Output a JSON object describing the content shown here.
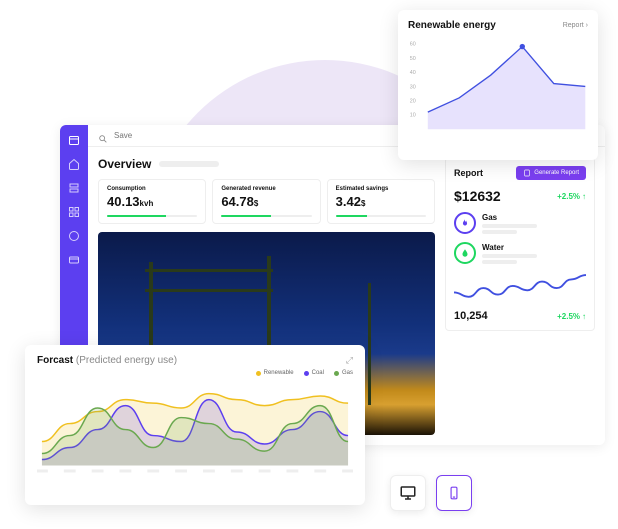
{
  "colors": {
    "primary": "#5c3ff0",
    "accent": "#7a3ff0",
    "green": "#1ed760"
  },
  "dots": "• • •",
  "search": {
    "placeholder": "Save"
  },
  "overview": {
    "title": "Overview"
  },
  "metrics": [
    {
      "label": "Consumption",
      "value": "40.13",
      "unit": "kvh",
      "progress": 65
    },
    {
      "label": "Generated revenue",
      "value": "64.78",
      "unit": "$",
      "progress": 55
    },
    {
      "label": "Estimated savings",
      "value": "3.42",
      "unit": "$",
      "progress": 35
    }
  ],
  "report": {
    "title": "Report",
    "generate_label": "Generate Report",
    "amount": "$12632",
    "change": "+2.5%",
    "resources": [
      {
        "name": "Gas",
        "kind": "gas"
      },
      {
        "name": "Water",
        "kind": "water"
      }
    ],
    "bottom_value": "10,254",
    "bottom_change": "+2.5%"
  },
  "renewable": {
    "title": "Renewable energy",
    "report_link": "Report"
  },
  "forecast": {
    "title": "Forcast",
    "subtitle": "(Predicted energy use)",
    "legend": [
      {
        "label": "Renewable",
        "color": "#f0c020"
      },
      {
        "label": "Coal",
        "color": "#5c3ff0"
      },
      {
        "label": "Gas",
        "color": "#6aa84f"
      }
    ]
  },
  "chart_data": [
    {
      "id": "renewable",
      "type": "area",
      "title": "Renewable energy",
      "ylabel": "",
      "ylim": [
        0,
        60
      ],
      "yticks": [
        10,
        20,
        30,
        40,
        50,
        60
      ],
      "x": [
        0,
        1,
        2,
        3,
        4,
        5
      ],
      "values": [
        12,
        22,
        38,
        58,
        32,
        30
      ]
    },
    {
      "id": "forecast",
      "type": "line",
      "title": "Forcast (Predicted energy use)",
      "x": [
        0,
        1,
        2,
        3,
        4,
        5,
        6,
        7,
        8,
        9,
        10,
        11
      ],
      "series": [
        {
          "name": "Renewable",
          "color": "#f0c020",
          "values": [
            20,
            35,
            45,
            55,
            52,
            48,
            60,
            55,
            50,
            55,
            58,
            52
          ]
        },
        {
          "name": "Coal",
          "color": "#5c3ff0",
          "values": [
            5,
            15,
            30,
            50,
            25,
            20,
            55,
            28,
            18,
            30,
            45,
            25
          ]
        },
        {
          "name": "Gas",
          "color": "#6aa84f",
          "values": [
            10,
            25,
            48,
            30,
            15,
            40,
            35,
            22,
            12,
            35,
            50,
            20
          ]
        }
      ],
      "ylim": [
        0,
        70
      ]
    },
    {
      "id": "report_spark",
      "type": "line",
      "x": [
        0,
        1,
        2,
        3,
        4,
        5,
        6,
        7,
        8,
        9
      ],
      "values": [
        18,
        14,
        22,
        16,
        24,
        20,
        28,
        22,
        30,
        34
      ],
      "ylim": [
        10,
        36
      ]
    }
  ]
}
